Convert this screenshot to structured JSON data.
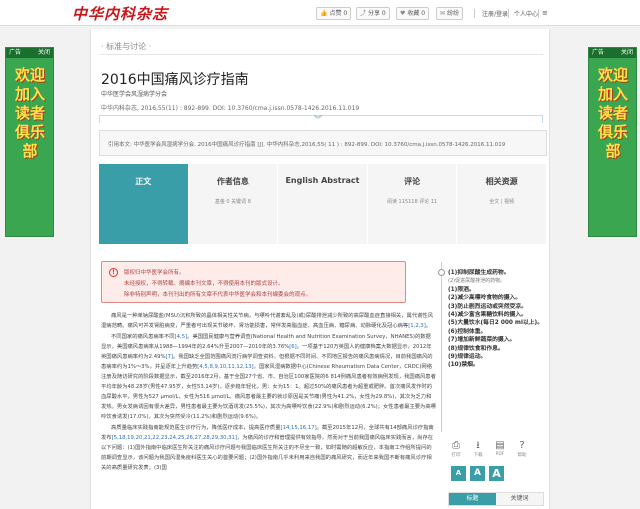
{
  "topbar": {
    "logo_text": "中华内科杂志",
    "buttons": [
      {
        "icon": "thumbs-up-icon",
        "glyph": "👍",
        "label": "点赞 0"
      },
      {
        "icon": "share-icon",
        "glyph": "⤴",
        "label": "分享 0"
      },
      {
        "icon": "favorite-icon",
        "glyph": "♥",
        "label": "收藏 0"
      },
      {
        "icon": "comment-icon",
        "glyph": "✉",
        "label": "纷纷"
      }
    ],
    "login_label": "注册/登录",
    "user_center_label": "个人中心"
  },
  "ads": {
    "label": "广告",
    "close_label": "关闭",
    "left_text": "欢迎加入读者俱乐部",
    "right_text": "欢迎加入读者俱乐部"
  },
  "article": {
    "breadcrumb": "· 标准与讨论 ·",
    "title": "2016中国痛风诊疗指南",
    "authors": "中华医学会风湿病学分会",
    "citation": "中华内科杂志, 2016,55(11) : 892-899. DOI: 10.3760/cma.j.issn.0578-1426.2016.11.019",
    "ref_line": "引用本文: 中华医学会风湿病学分会. 2016中国痛风诊疗指南 [J]. 中华内科杂志,2016,55( 11 ) : 892-899. DOI: 10.3760/cma.j.issn.0578-1426.2016.11.019"
  },
  "tabs": [
    {
      "label": "正文",
      "sub": ""
    },
    {
      "label": "作者信息",
      "sub": "基金 0  关键词 8"
    },
    {
      "label": "English Abstract",
      "sub": ""
    },
    {
      "label": "评论",
      "sub": "阅读 115118  评论 11"
    },
    {
      "label": "相关资源",
      "sub": "全文 | 视频"
    }
  ],
  "notice": {
    "lines": [
      "版权归中华医学会所有。",
      "未经授权，不得转载、摘编本刊文章，不得使用本刊的版式设计。",
      "除非特别声明，本刊刊出的所有文章不代表中华医学会和本刊编委会的观点。"
    ]
  },
  "body": {
    "p1": "痛风是一种单钠尿酸盐(MSU)沉积所致的晶体相关性关节病，与嘌呤代谢紊乱及(或)尿酸排泄减少所致的高尿酸血症直接相关，属代谢性风湿病范畴。痛风可并发肾脏病变，严重者可出现关节破坏、肾功能损害，常伴发高脂血症、高血压病、糖尿病、动脉硬化及冠心病等",
    "p1_ref": "[1,2,3]",
    "p2": "不同国家的痛风患病率不同",
    "p2_ref": "[4,5]",
    "p2b": "。美国国民健康与营养调查(National Health and Nutrition Examination Survey，NHANES)的数据显示，美国痛风患病率从1988—1994年的2.64%升至2007—2010年的3.76%",
    "p2b_ref": "[6]",
    "p2c": "。一项基于120万英国人的健康档案大数据显示，2012年英国痛风患病率约为2.49%",
    "p2c_ref": "[7]",
    "p2d": "。我国缺乏全国范围痛风流行病学调查资料，但根据不同时间、不同地区报告的痛风患病情况，目前我国痛风的患病率约为1%～3%，并呈逐年上升趋势",
    "p2d_ref": "[4,5,8,9,10,11,12,13]",
    "p2e": "。国家风湿病数据中心(Chinese Rheumatism Data Center，CRDC)网络注册及随访研究的阶段数据显示，截至2016年2月，基于全国27个省、市、自治区100家医院的6 814例痛风患者有效病例发现，我国痛风患者平均年龄为48.28岁(男性47.95岁，女性53.14岁)，逐步趋年轻化，男：女为15：1。超过50%的痛风患者为超重或肥胖。首次痛风发作时的血尿酸水平，男性为527 μmol/L，女性为516 μmol/L。痛风患者最主要的就诊原因是关节痛(男性为41.2%，女性为29.8%)，其次为乏力和发热。男女发病诱因有很大差异，男性患者最主要为饮酒诱发(25.5%)，其次为高嘌呤饮食(22.9%)和剧烈运动(6.2%)；女性患者最主要为高嘌呤饮食诱发(17.0%)，其次为突然受冷(11.2%)和剧烈运动(9.6%)。",
    "p3": "高质量临床实践指南能规范医生诊疗行为，降低医疗成本，提高医疗质量",
    "p3_ref": "[14,15,16,17]",
    "p3b": "。截至2015年12月，全球共有14部痛风诊疗指南发布",
    "p3b_ref": "[5,18,19,20,21,22,23,24,25,26,27,28,29,30,31]",
    "p3c": "，为痛风的诊疗和管理提供有效指导，然而对于当前我国痛风临床实践而言，尚存在以下问题：(1)国外指南中临床医生所关注的痛风诊疗问题与我国临床医生所关注的不尽全一致，如时需随的超敏反应，本指南工作组所提问的前期调查显示，该问题为我国风湿免疫科医生关心的首要问题；(2)国外指南几乎未利用来自我国的痛风研究，而近年来我国不断有痛风诊疗相关的高质量研究发表；(3)国"
  },
  "toc": {
    "items": [
      {
        "label": "(1)抑制尿酸生成药物。",
        "sub": false
      },
      {
        "label": "(2)促进尿酸排泄的药物。",
        "sub": true
      },
      {
        "label": "(1)限酒。",
        "sub": false
      },
      {
        "label": "(2)减少高嘌呤食物的摄入。",
        "sub": false
      },
      {
        "label": "(3)防止剧烈运动或突然受凉。",
        "sub": false
      },
      {
        "label": "(4)减少富含果糖饮料的摄入。",
        "sub": false
      },
      {
        "label": "(5)大量饮水(每日2 000 ml以上)。",
        "sub": false
      },
      {
        "label": "(6)控制体重。",
        "sub": false
      },
      {
        "label": "(7)增加新鲜蔬菜的摄入。",
        "sub": false
      },
      {
        "label": "(8)规律饮食和作息。",
        "sub": false
      },
      {
        "label": "(9)规律运动。",
        "sub": false
      },
      {
        "label": "(10)禁烟。",
        "sub": false
      }
    ]
  },
  "tools": [
    {
      "icon": "print-icon",
      "glyph": "⎙",
      "label": "打印"
    },
    {
      "icon": "download-icon",
      "glyph": "⭳",
      "label": "下载"
    },
    {
      "icon": "pdf-icon",
      "glyph": "▤",
      "label": "PDF"
    },
    {
      "icon": "help-icon",
      "glyph": "?",
      "label": "帮助"
    }
  ],
  "font_buttons": [
    "A",
    "A",
    "A"
  ],
  "right_tabs": [
    "标题",
    "关键词"
  ],
  "colors": {
    "accent": "#3a9ea8",
    "brand": "#c8161d",
    "ad_green": "#3aa650"
  }
}
